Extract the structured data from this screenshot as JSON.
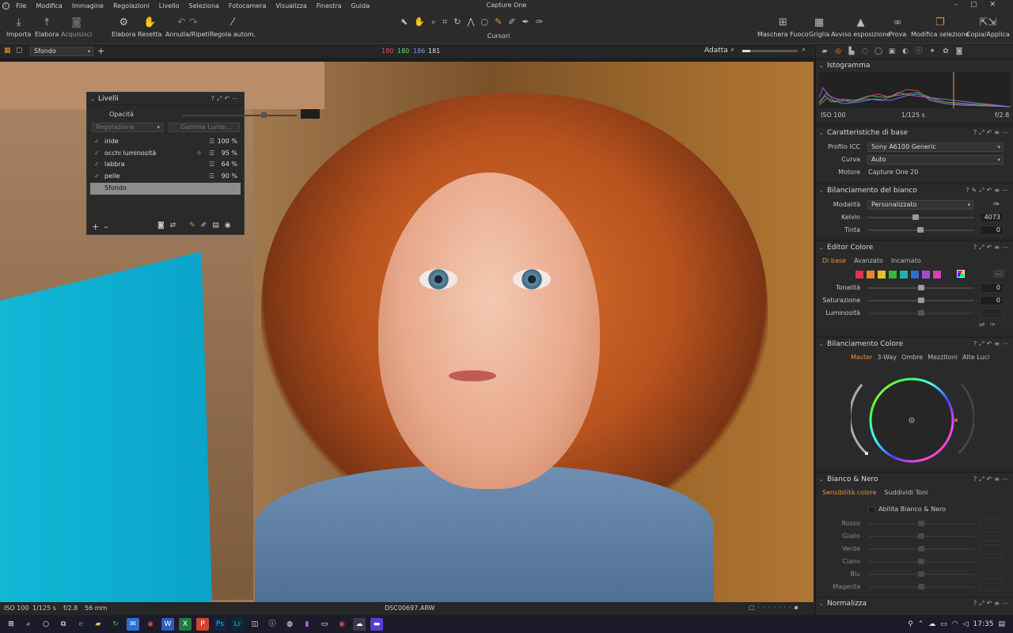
{
  "app": {
    "title": "Capture One"
  },
  "menu": [
    "File",
    "Modifica",
    "Immagine",
    "Regolazioni",
    "Livello",
    "Seleziona",
    "Fotocamera",
    "Visualizza",
    "Finestra",
    "Guida"
  ],
  "toolbar": {
    "left": [
      {
        "label": "Importa",
        "icon": "download-icon"
      },
      {
        "label": "Elabora",
        "icon": "upload-icon"
      },
      {
        "label": "Acquisisci",
        "icon": "camera-icon"
      },
      {
        "label": "Elabora",
        "icon": "gear-icon"
      },
      {
        "label": "Resetta",
        "icon": "reset-hand-icon"
      },
      {
        "label": "Annulla/Ripeti",
        "icon": "undo-redo-icon"
      },
      {
        "label": "Regola autom.",
        "icon": "magic-wand-icon"
      }
    ],
    "cursors_label": "Cursori",
    "right": [
      {
        "label": "Maschera Fuoco",
        "icon": "focus-mask-icon"
      },
      {
        "label": "Griglia",
        "icon": "grid-icon"
      },
      {
        "label": "Avviso esposizione",
        "icon": "warning-icon"
      },
      {
        "label": "Prova",
        "icon": "glasses-icon"
      },
      {
        "label": "Modifica selezione",
        "icon": "layers-orange-icon"
      },
      {
        "label": "Copia/Applica",
        "icon": "copy-apply-icon"
      }
    ]
  },
  "subtoolbar": {
    "layer_select": "Sfondo",
    "rgb": {
      "r": "180",
      "g": "180",
      "b": "186",
      "a": "181"
    },
    "zoom_label": "Adatta"
  },
  "layers_panel": {
    "title": "Livelli",
    "opacity_label": "Opacità",
    "adjust_label": "Regolazione",
    "luma_label": "Gamma Luma...",
    "layers": [
      {
        "name": "iride",
        "pct": "100 %",
        "checked": true
      },
      {
        "name": "occhi luminosità",
        "pct": "95 %",
        "checked": true
      },
      {
        "name": "labbra",
        "pct": "64 %",
        "checked": true
      },
      {
        "name": "pelle",
        "pct": "90 %",
        "checked": true
      },
      {
        "name": "Sfondo",
        "pct": "",
        "checked": false
      }
    ]
  },
  "statusbar": {
    "iso": "ISO 100",
    "shutter": "1/125 s",
    "aperture": "f/2.8",
    "focal": "56 mm",
    "filename": "DSC00697.ARW"
  },
  "histogram": {
    "title": "Istogramma",
    "iso": "ISO 100",
    "shutter": "1/125 s",
    "aperture": "f/2.8"
  },
  "base": {
    "title": "Caratteristiche di base",
    "icc_label": "Profilo ICC",
    "icc_value": "Sony A6100 Generic",
    "curve_label": "Curva",
    "curve_value": "Auto",
    "engine_label": "Motore",
    "engine_value": "Capture One 20"
  },
  "wb": {
    "title": "Bilanciamento del bianco",
    "mode_label": "Modalità",
    "mode_value": "Personalizzato",
    "kelvin_label": "Kelvin",
    "kelvin_value": "4073",
    "tint_label": "Tinta",
    "tint_value": "0"
  },
  "color_editor": {
    "title": "Editor Colore",
    "tabs": [
      "Di base",
      "Avanzato",
      "Incarnato"
    ],
    "swatches": [
      "#d9364a",
      "#e8852a",
      "#e0c22a",
      "#39b53a",
      "#25b0b0",
      "#2f6bd6",
      "#a14ed0",
      "#d940b0"
    ],
    "hue_label": "Tonalità",
    "hue_value": "0",
    "sat_label": "Saturazione",
    "sat_value": "0",
    "lum_label": "Luminosità"
  },
  "color_balance": {
    "title": "Bilanciamento Colore",
    "tabs": [
      "Master",
      "3-Way",
      "Ombre",
      "Mezzitoni",
      "Alte Luci"
    ]
  },
  "bw": {
    "title": "Bianco & Nero",
    "tabs": [
      "Sensibilità colore",
      "Suddividi Toni"
    ],
    "enable_label": "Abilita Bianco & Nero",
    "channels": [
      "Rosso",
      "Giallo",
      "Verde",
      "Ciano",
      "Blu",
      "Magenta"
    ]
  },
  "normalize": {
    "title": "Normalizza"
  },
  "taskbar": {
    "time": "17:35"
  }
}
